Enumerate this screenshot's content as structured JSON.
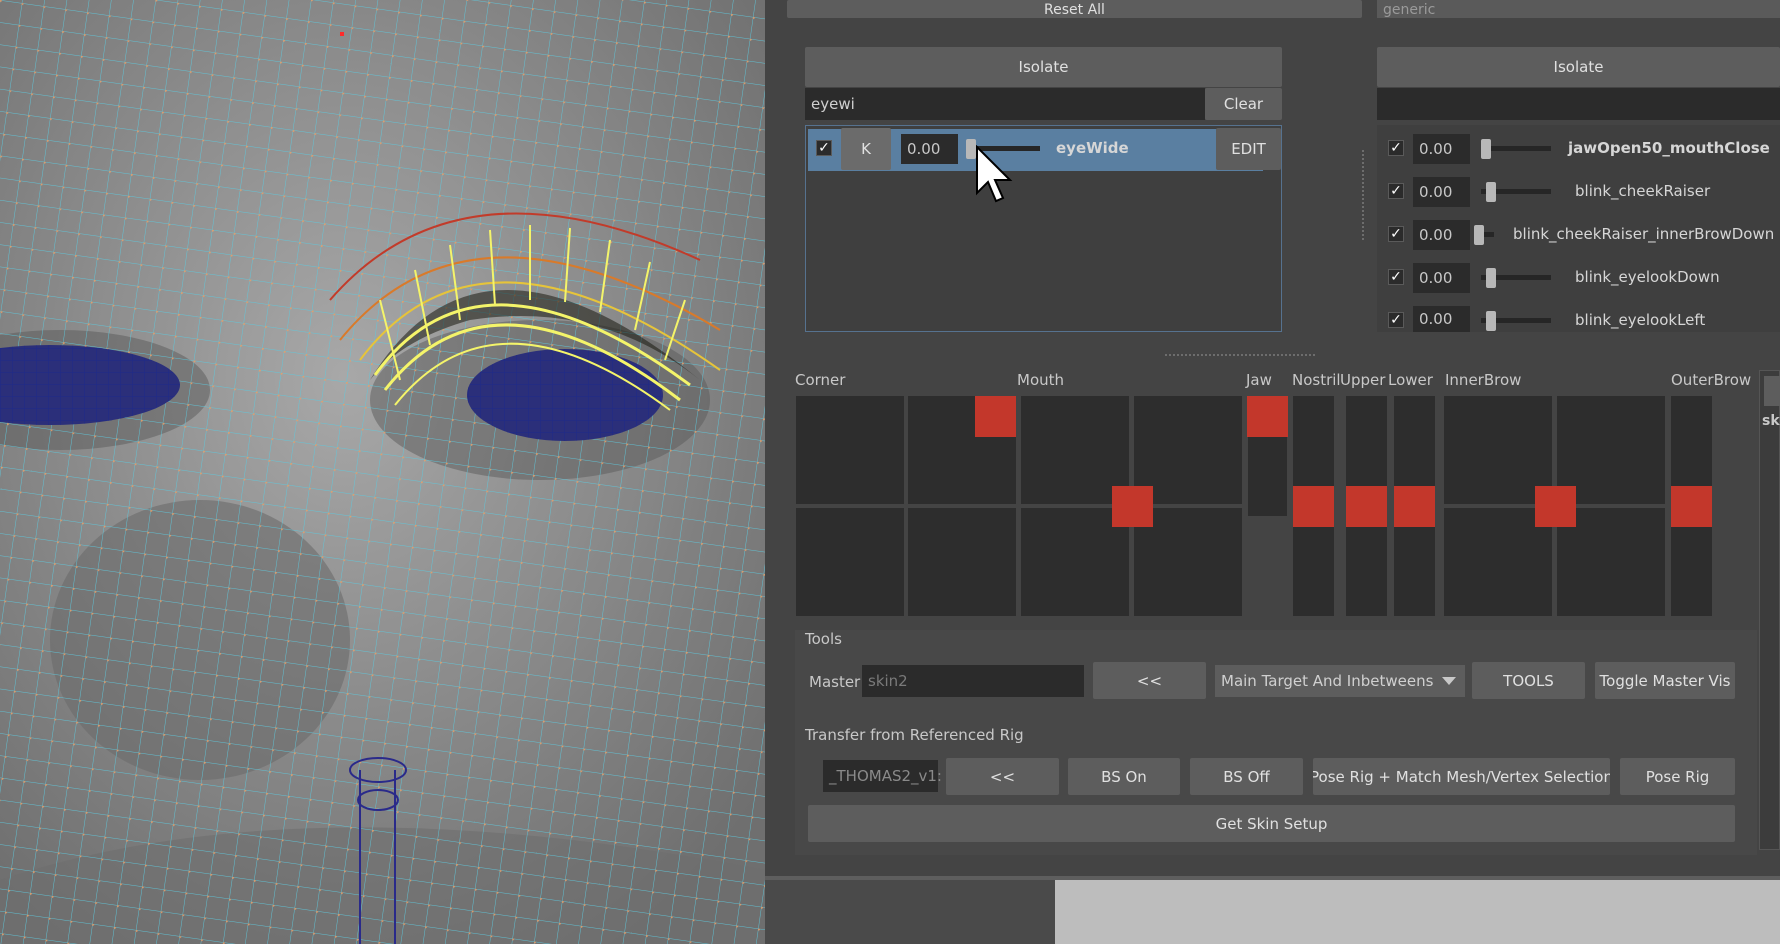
{
  "top": {
    "reset_all": "Reset All",
    "preset_value": "generic"
  },
  "left_panel": {
    "isolate": "Isolate",
    "search_value": "eyewi",
    "clear": "Clear",
    "row": {
      "checked": true,
      "key_label": "K",
      "value": "0.00",
      "slider_fraction": 0.0,
      "name": "eyeWide",
      "edit": "EDIT"
    }
  },
  "right_panel": {
    "isolate": "Isolate",
    "search_value": "",
    "rows": [
      {
        "checked": true,
        "value": "0.00",
        "name": "jawOpen50_mouthClose",
        "bold": true
      },
      {
        "checked": true,
        "value": "0.00",
        "name": "blink_cheekRaiser"
      },
      {
        "checked": true,
        "value": "0.00",
        "name": "blink_cheekRaiser_innerBrowDown"
      },
      {
        "checked": true,
        "value": "0.00",
        "name": "blink_eyelookDown"
      },
      {
        "checked": true,
        "value": "0.00",
        "name": "blink_eyelookLeft"
      }
    ]
  },
  "controls": {
    "labels": {
      "corner": "Corner",
      "mouth": "Mouth",
      "jaw": "Jaw",
      "nostril": "Nostril",
      "upper": "Upper",
      "lower": "Lower",
      "innerbrow": "InnerBrow",
      "outerbrow": "OuterBrow"
    },
    "marker_color": "#c3372b",
    "side_label": "sk"
  },
  "tools": {
    "title": "Tools",
    "master_label": "Master",
    "master_value": "skin2",
    "back_button": "<<",
    "mode_selected": "Main Target And Inbetweens",
    "tools_button": "TOOLS",
    "toggle_master": "Toggle Master Vis"
  },
  "transfer": {
    "title": "Transfer from Referenced Rig",
    "rig_value": "_THOMAS2_v1:",
    "back_button": "<<",
    "bs_on": "BS On",
    "bs_off": "BS Off",
    "pose_match": "Pose Rig + Match Mesh/Vertex Selection",
    "pose_rig": "Pose Rig",
    "get_skin": "Get Skin Setup"
  }
}
